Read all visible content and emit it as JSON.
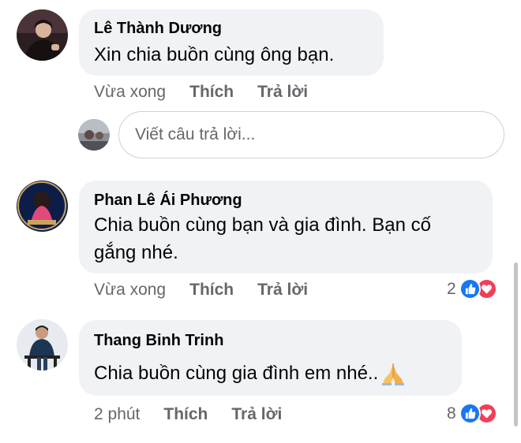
{
  "comments": [
    {
      "author": "Lê Thành Dương",
      "text": "Xin chia buồn cùng ông bạn.",
      "time": "Vừa xong",
      "like_label": "Thích",
      "reply_label": "Trả lời",
      "reaction_count": ""
    },
    {
      "author": "Phan Lê Ái Phương",
      "text_line1": "Chia buồn cùng bạn và gia đình. Bạn cố",
      "text_line2": "gắng nhé.",
      "time": "Vừa xong",
      "like_label": "Thích",
      "reply_label": "Trả lời",
      "reaction_count": "2"
    },
    {
      "author": "Thang Binh Trinh",
      "text": "Chia buồn cùng gia đình em nhé..",
      "emoji": "🙏",
      "time": "2 phút",
      "like_label": "Thích",
      "reply_label": "Trả lời",
      "reaction_count": "8"
    }
  ],
  "reply_box": {
    "placeholder": "Viết câu trả lời..."
  },
  "icons": {
    "like": "thumbs-up-icon",
    "love": "heart-icon",
    "emoji": "folded-hands-icon"
  },
  "colors": {
    "bubble": "#f0f2f5",
    "meta_text": "#65676b",
    "like_blue": "#1877f2",
    "love_red": "#f33e58"
  }
}
